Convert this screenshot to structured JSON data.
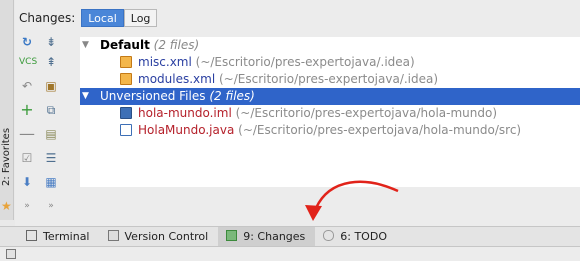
{
  "favorites": {
    "label": "2: Favorites"
  },
  "changes_header": {
    "title": "Changes:",
    "tabs": [
      {
        "label": "Local",
        "active": true
      },
      {
        "label": "Log",
        "active": false
      }
    ]
  },
  "tree": {
    "groups": [
      {
        "name": "Default",
        "count": "(2 files)",
        "selected": false,
        "files": [
          {
            "name": "misc.xml",
            "path": "(~/Escritorio/pres-expertojava/.idea)",
            "name_color": "#2a3fa1"
          },
          {
            "name": "modules.xml",
            "path": "(~/Escritorio/pres-expertojava/.idea)",
            "name_color": "#2a3fa1"
          }
        ]
      },
      {
        "name": "Unversioned Files",
        "count": "(2 files)",
        "selected": true,
        "files": [
          {
            "name": "hola-mundo.iml",
            "path": "(~/Escritorio/pres-expertojava/hola-mundo)",
            "name_color": "#b5212b"
          },
          {
            "name": "HolaMundo.java",
            "path": "(~/Escritorio/pres-expertojava/hola-mundo/src)",
            "name_color": "#b5212b"
          }
        ]
      }
    ]
  },
  "bottom_tabs": [
    {
      "label": "Terminal",
      "active": false
    },
    {
      "label": "Version Control",
      "active": false
    },
    {
      "label": "9: Changes",
      "active": true
    },
    {
      "label": "6: TODO",
      "active": false
    }
  ],
  "colors": {
    "selection": "#2f64c9",
    "annotation_arrow": "#e1231a",
    "accent": "#4a86d8"
  }
}
